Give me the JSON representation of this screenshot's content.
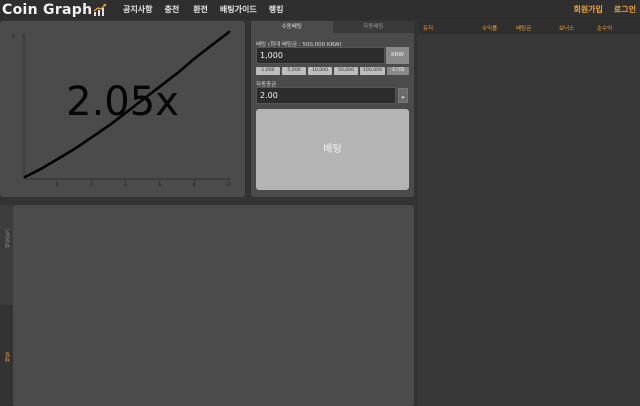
{
  "header": {
    "logo_text": "Coin Graph",
    "nav": [
      "공지사항",
      "충전",
      "환전",
      "배팅가이드",
      "랭킹"
    ],
    "auth": {
      "signup": "회원가입",
      "login": "로그인"
    }
  },
  "game": {
    "multiplier": "2.05x",
    "chart_data": {
      "type": "line",
      "x_ticks": [
        "0",
        "2",
        "4",
        "6",
        "8",
        "10"
      ],
      "y_top_label": "8",
      "xlim": [
        0,
        12
      ],
      "x": [
        0,
        1,
        2,
        3,
        4,
        5,
        6,
        7,
        8,
        9,
        10,
        11,
        12
      ],
      "y": [
        0.0,
        0.06,
        0.13,
        0.2,
        0.28,
        0.36,
        0.45,
        0.54,
        0.63,
        0.72,
        0.82,
        0.91,
        1.0
      ],
      "curve_color": "#000000"
    }
  },
  "bet": {
    "tabs": {
      "manual": "수동배팅",
      "auto": "자동배팅"
    },
    "amount_label": "배팅 (최대 배팅금 : 500,000 KRW)",
    "amount_value": "1,000",
    "currency": "KRW",
    "quick_amounts": [
      "1,000",
      "5,000",
      "10,000",
      "50,000",
      "100,000"
    ],
    "reset_label": "초기화",
    "auto_cashout_label": "자동중금",
    "auto_cashout_value": "2.00",
    "bet_button": "배팅"
  },
  "players": {
    "columns": [
      "유저",
      "수익률",
      "배팅금",
      "보너스",
      "순수익"
    ],
    "accent_color": "#f0a23a"
  },
  "bottom": {
    "side_tab": "채팅닫기",
    "side_label": "채팅"
  }
}
